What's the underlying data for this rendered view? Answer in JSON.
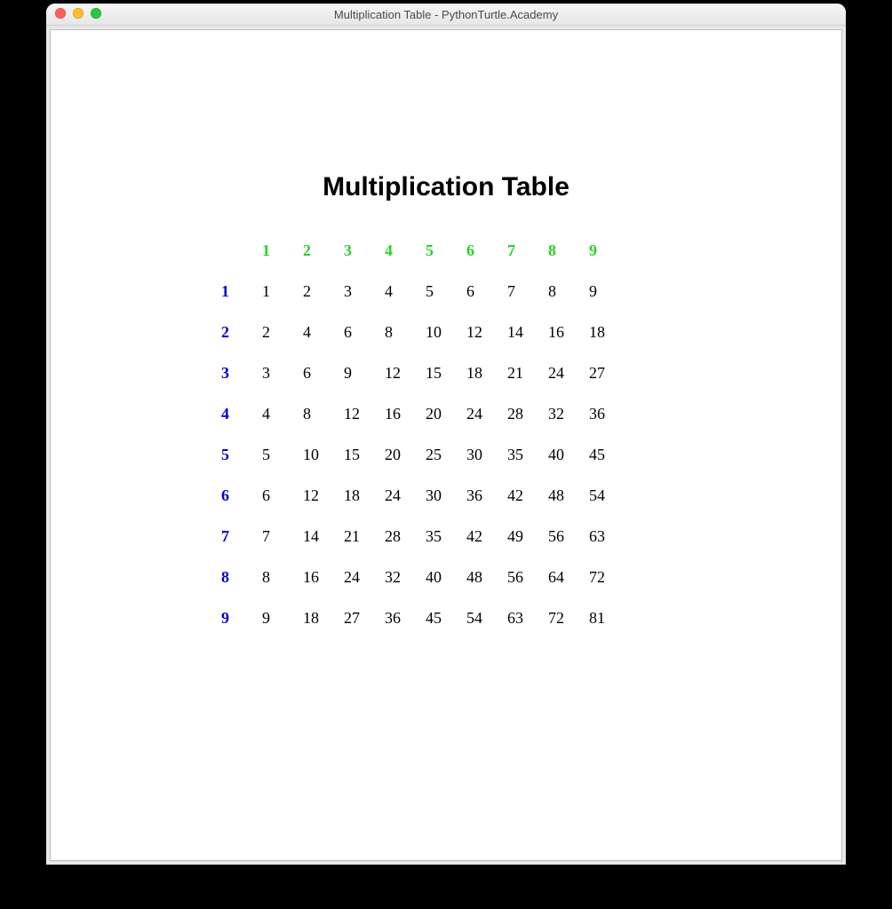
{
  "window": {
    "title": "Multiplication Table - PythonTurtle.Academy"
  },
  "content": {
    "heading": "Multiplication Table"
  },
  "chart_data": {
    "type": "table",
    "title": "Multiplication Table",
    "col_headers": [
      1,
      2,
      3,
      4,
      5,
      6,
      7,
      8,
      9
    ],
    "row_headers": [
      1,
      2,
      3,
      4,
      5,
      6,
      7,
      8,
      9
    ],
    "values": [
      [
        1,
        2,
        3,
        4,
        5,
        6,
        7,
        8,
        9
      ],
      [
        2,
        4,
        6,
        8,
        10,
        12,
        14,
        16,
        18
      ],
      [
        3,
        6,
        9,
        12,
        15,
        18,
        21,
        24,
        27
      ],
      [
        4,
        8,
        12,
        16,
        20,
        24,
        28,
        32,
        36
      ],
      [
        5,
        10,
        15,
        20,
        25,
        30,
        35,
        40,
        45
      ],
      [
        6,
        12,
        18,
        24,
        30,
        36,
        42,
        48,
        54
      ],
      [
        7,
        14,
        21,
        28,
        35,
        42,
        49,
        56,
        63
      ],
      [
        8,
        16,
        24,
        32,
        40,
        48,
        56,
        64,
        72
      ],
      [
        9,
        18,
        27,
        36,
        45,
        54,
        63,
        72,
        81
      ]
    ],
    "colors": {
      "col_header": "#2ad02a",
      "row_header": "#0000d8",
      "body": "#000000"
    }
  }
}
